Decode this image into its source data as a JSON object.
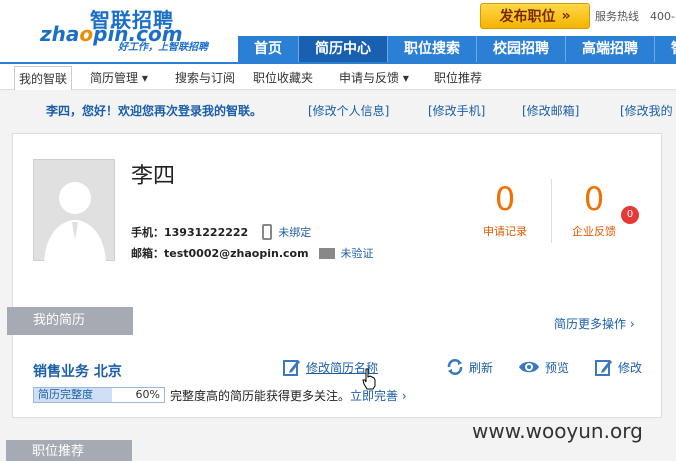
{
  "header": {
    "logo_cn": "智联招聘",
    "logo_en_pre": "zha",
    "logo_en_o": "o",
    "logo_en_post": "pin.com",
    "slogan": "好工作，上智联招聘",
    "publish_label": "发布职位",
    "publish_icon": "»",
    "hotline": "服务热线　400-"
  },
  "nav": [
    {
      "label": "首页"
    },
    {
      "label": "简历中心"
    },
    {
      "label": "职位搜索"
    },
    {
      "label": "校园招聘"
    },
    {
      "label": "高端招聘"
    },
    {
      "label": "智"
    }
  ],
  "subnav": [
    {
      "label": "我的智联"
    },
    {
      "label": "简历管理 ▾"
    },
    {
      "label": "搜索与订阅"
    },
    {
      "label": "职位收藏夹"
    },
    {
      "label": "申请与反馈 ▾"
    },
    {
      "label": "职位推荐"
    }
  ],
  "welcome": {
    "text": "李四，您好！欢迎您再次登录我的智联。",
    "links": [
      "[修改个人信息]",
      "[修改手机]",
      "[修改邮箱]",
      "[修改我的"
    ]
  },
  "profile": {
    "name": "李四",
    "phone_label": "手机：",
    "phone_value": "13931222222",
    "phone_status": "未绑定",
    "email_label": "邮箱：",
    "email_value": "test0002@zhaopin.com",
    "email_status": "未验证"
  },
  "stats": {
    "apply_count": "0",
    "apply_label": "申请记录",
    "feedback_count": "0",
    "feedback_label": "企业反馈",
    "feedback_badge": "0"
  },
  "resume": {
    "section_title": "我的简历",
    "more_ops": "简历更多操作",
    "title": "销售业务  北京",
    "edit_name": "修改简历名称",
    "refresh": "刷新",
    "preview": "预览",
    "edit": "修改",
    "completeness_label": "简历完整度",
    "completeness_pct": "60%",
    "completeness": 0.6,
    "tip": "完整度高的简历能获得更多关注。",
    "tip_link": "立即完善"
  },
  "bottom": {
    "recommend_title": "职位推荐"
  },
  "watermark": "www.wooyun.org",
  "colors": {
    "brand_blue": "#1b6fc8",
    "nav_blue": "#2b7fd4",
    "link_blue": "#1b5fa8",
    "accent_orange": "#f07000",
    "badge_red": "#e53935"
  }
}
